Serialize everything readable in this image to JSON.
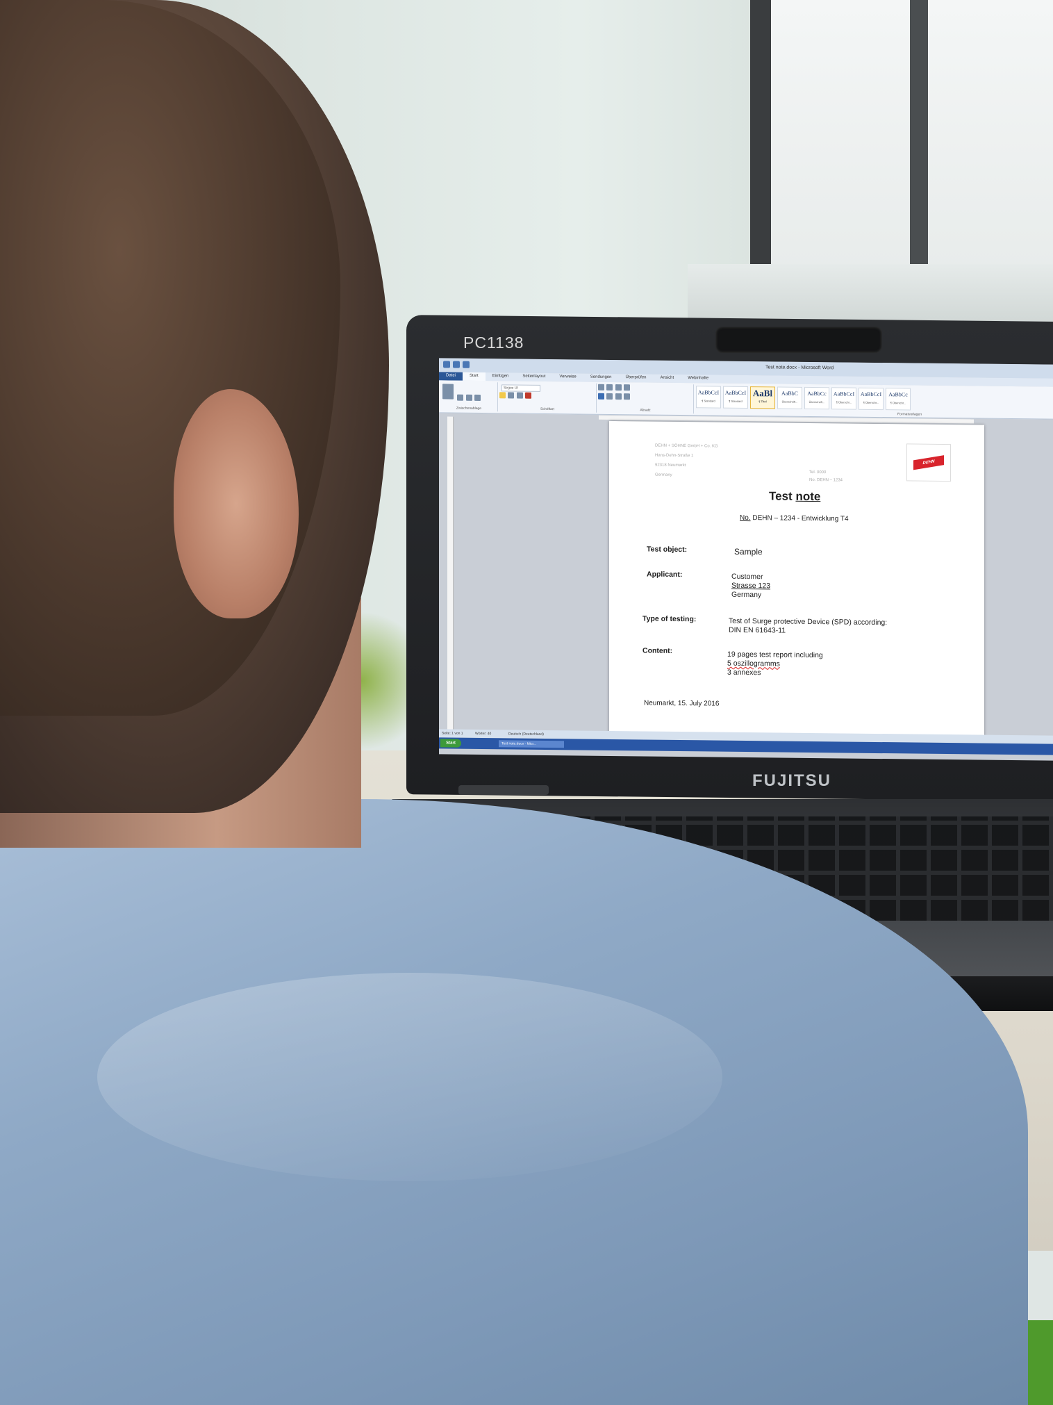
{
  "laptop": {
    "asset_tag": "PC1138",
    "brand": "FUJITSU"
  },
  "word": {
    "window_title": "Test note.docx - Microsoft Word",
    "tabs": [
      "Datei",
      "Start",
      "Einfügen",
      "Seitenlayout",
      "Verweise",
      "Sendungen",
      "Überprüfen",
      "Ansicht",
      "Webinhalte"
    ],
    "ribbon_groups": [
      "Zwischenablage",
      "Schriftart",
      "Absatz",
      "Formatvorlagen"
    ],
    "font_name": "Segoe UI",
    "styles": [
      {
        "sample": "AaBbCcI",
        "name": "¶ Standard"
      },
      {
        "sample": "AaBbCcI",
        "name": "¶ Standard"
      },
      {
        "sample": "AaBl",
        "name": "¶ Titel"
      },
      {
        "sample": "AaBbC",
        "name": "Überschrift..."
      },
      {
        "sample": "AaBbCc",
        "name": "Überschrift..."
      },
      {
        "sample": "AaBbCcI",
        "name": "¶ Überschr..."
      },
      {
        "sample": "AaBbCcI",
        "name": "¶ Überschr..."
      },
      {
        "sample": "AaBbCc",
        "name": "¶ Überschr..."
      }
    ],
    "status": {
      "page": "Seite: 1 von 1",
      "words": "Wörter: 40",
      "language": "Deutsch (Deutschland)"
    },
    "taskbar": {
      "start": "Start",
      "task": "Test note.docx - Micr..."
    }
  },
  "document": {
    "sender_lines": [
      "DEHN + SÖHNE GmbH + Co. KG",
      "Hans-Dehn-Straße 1",
      "92318 Neumarkt",
      "Germany"
    ],
    "ref_lines": [
      "Tel. 0000",
      "No. DEHN – 1234"
    ],
    "logo_text": "DEHN",
    "title_word_1": "Test",
    "title_word_2": "note",
    "number_prefix": "No.",
    "number_rest": "DEHN – 1234 - Entwicklung T4",
    "fields": [
      {
        "label": "Test object:",
        "lines": [
          "Sample"
        ]
      },
      {
        "label": "Applicant:",
        "lines": [
          "Customer",
          "Strasse 123",
          "Germany"
        ]
      },
      {
        "label": "Type of testing:",
        "lines": [
          "Test of Surge protective Device (SPD) according:",
          "DIN EN 61643-11"
        ]
      },
      {
        "label": "Content:",
        "lines": [
          "19 pages test report including",
          "5 oszillogramms",
          "3 annexes"
        ]
      }
    ],
    "place_date": "Neumarkt, 15. July 2016"
  }
}
